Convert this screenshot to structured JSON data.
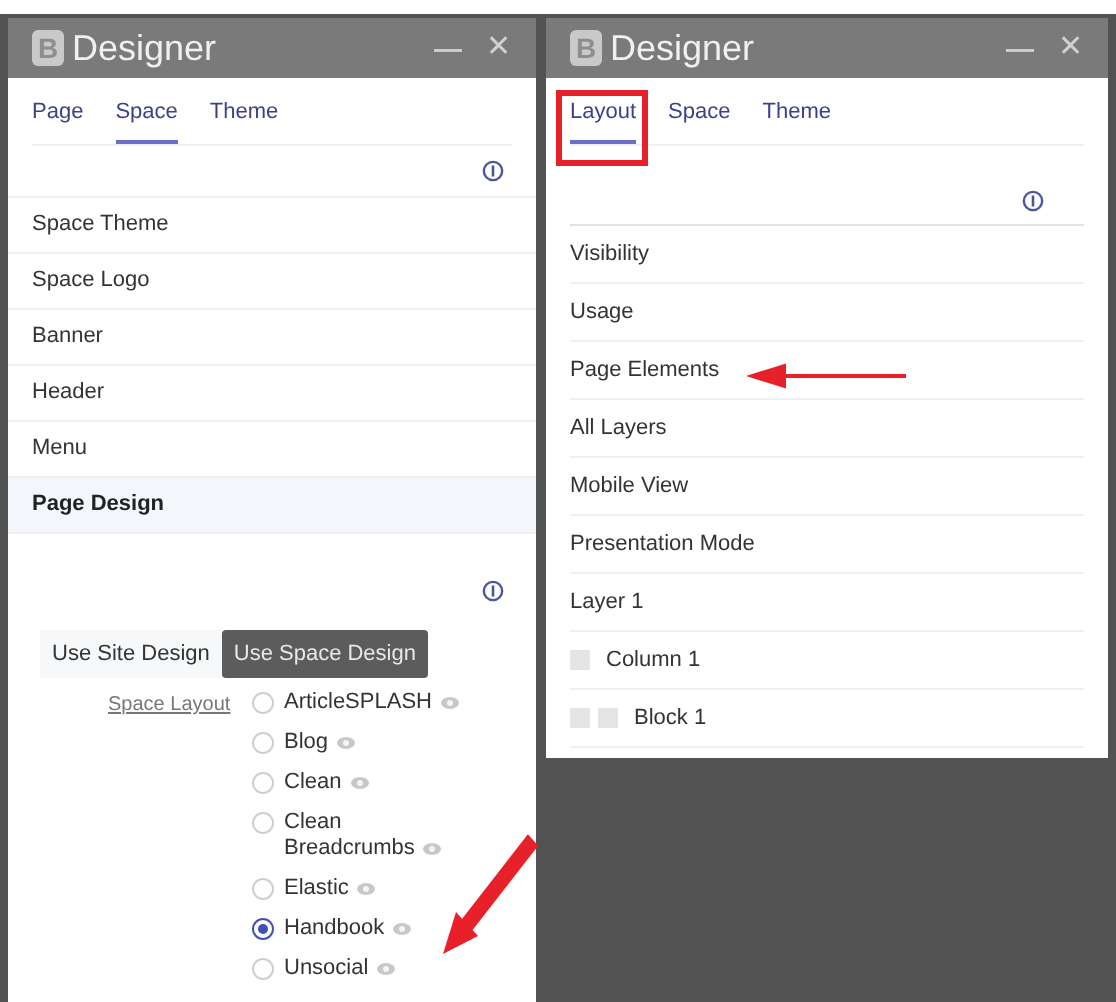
{
  "left_panel": {
    "logo": "B",
    "title": "Designer",
    "minimize": "—",
    "close": "✕",
    "tabs": [
      {
        "label": "Page",
        "selected": false
      },
      {
        "label": "Space",
        "selected": true
      },
      {
        "label": "Theme",
        "selected": false
      }
    ],
    "items": [
      {
        "label": "Space Theme",
        "selected": false
      },
      {
        "label": "Space Logo",
        "selected": false
      },
      {
        "label": "Banner",
        "selected": false
      },
      {
        "label": "Header",
        "selected": false
      },
      {
        "label": "Menu",
        "selected": false
      },
      {
        "label": "Page Design",
        "selected": true
      }
    ],
    "design_toggle": [
      {
        "label": "Use Site Design",
        "selected": false
      },
      {
        "label": "Use Space Design",
        "selected": true
      }
    ],
    "layout_label": "Space Layout",
    "layouts": [
      {
        "label": "ArticleSPLASH",
        "selected": false
      },
      {
        "label": "Blog",
        "selected": false
      },
      {
        "label": "Clean",
        "selected": false
      },
      {
        "label": "Clean Breadcrumbs",
        "selected": false
      },
      {
        "label": "Elastic",
        "selected": false
      },
      {
        "label": "Handbook",
        "selected": true
      },
      {
        "label": "Unsocial",
        "selected": false
      }
    ]
  },
  "right_panel": {
    "logo": "B",
    "title": "Designer",
    "minimize": "—",
    "close": "✕",
    "tabs": [
      {
        "label": "Layout",
        "selected": true
      },
      {
        "label": "Space",
        "selected": false
      },
      {
        "label": "Theme",
        "selected": false
      }
    ],
    "items": [
      {
        "label": "Visibility"
      },
      {
        "label": "Usage"
      },
      {
        "label": "Page Elements"
      },
      {
        "label": "All Layers"
      },
      {
        "label": "Mobile View"
      },
      {
        "label": "Presentation Mode"
      },
      {
        "label": "Layer 1",
        "children": [
          {
            "label": "Column 1",
            "children": [
              {
                "label": "Block 1"
              }
            ]
          }
        ]
      }
    ]
  }
}
